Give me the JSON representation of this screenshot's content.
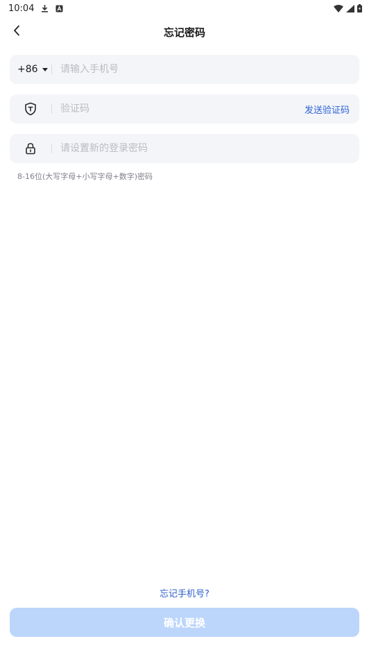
{
  "status_bar": {
    "time": "10:04",
    "icons": [
      "download-icon",
      "notification-a-icon",
      "wifi-icon",
      "signal-icon",
      "battery-icon"
    ]
  },
  "header": {
    "title": "忘记密码",
    "back_icon": "chevron-left-icon"
  },
  "form": {
    "phone": {
      "country_code": "+86",
      "placeholder": "请输入手机号",
      "value": ""
    },
    "code": {
      "icon": "shield-icon",
      "placeholder": "验证码",
      "value": "",
      "send_label": "发送验证码"
    },
    "password": {
      "icon": "lock-icon",
      "placeholder": "请设置新的登录密码",
      "value": ""
    },
    "hint": "8-16位(大写字母+小写字母+数字)密码"
  },
  "footer": {
    "forgot_phone": "忘记手机号?",
    "confirm_label": "确认更换"
  },
  "colors": {
    "accent": "#2c63d8",
    "button_disabled": "#bcd6fb",
    "field_bg": "#f4f5f8"
  }
}
